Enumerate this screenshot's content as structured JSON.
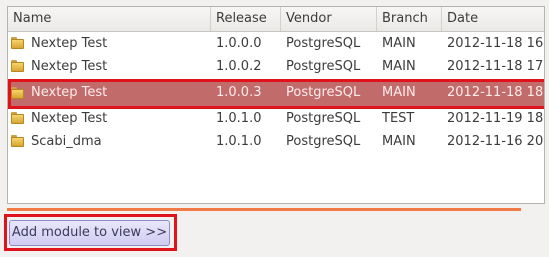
{
  "table": {
    "columns": [
      "Name",
      "Release",
      "Vendor",
      "Branch",
      "Date"
    ],
    "rows": [
      {
        "name": "Nextep Test",
        "release": "1.0.0.0",
        "vendor": "PostgreSQL",
        "branch": "MAIN",
        "date": "2012-11-18 16:",
        "selected": false
      },
      {
        "name": "Nextep Test",
        "release": "1.0.0.2",
        "vendor": "PostgreSQL",
        "branch": "MAIN",
        "date": "2012-11-18 17:",
        "selected": false
      },
      {
        "name": "Nextep Test",
        "release": "1.0.0.3",
        "vendor": "PostgreSQL",
        "branch": "MAIN",
        "date": "2012-11-18 18:",
        "selected": true
      },
      {
        "name": "Nextep Test",
        "release": "1.0.1.0",
        "vendor": "PostgreSQL",
        "branch": "TEST",
        "date": "2012-11-19 18:",
        "selected": false
      },
      {
        "name": "Scabi_dma",
        "release": "1.0.1.0",
        "vendor": "PostgreSQL",
        "branch": "MAIN",
        "date": "2012-11-16 20:",
        "selected": false
      }
    ],
    "row_icon": "folder-icon"
  },
  "add_button": {
    "label": "Add module to view >>"
  },
  "colors": {
    "selection": "#c26b6b",
    "highlight_outline": "#e0121c",
    "progress": "#f07b46"
  }
}
